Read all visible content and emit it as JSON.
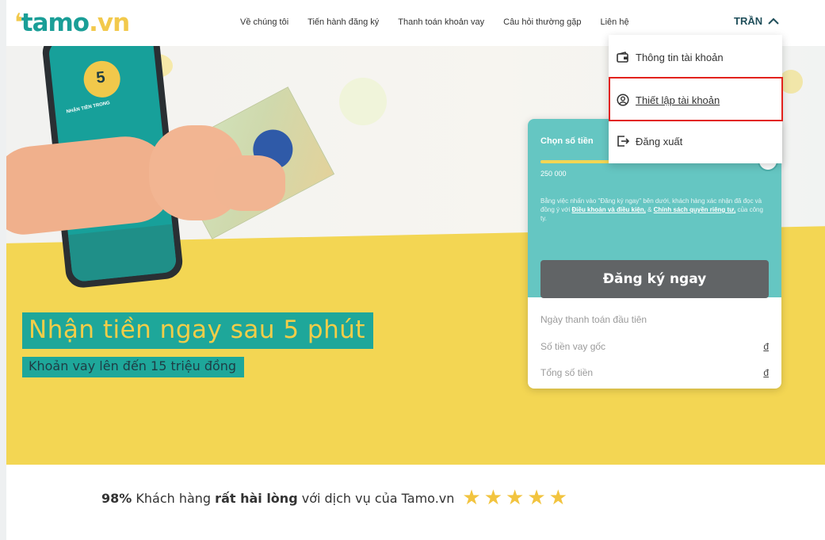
{
  "brand": {
    "logo_mark": "❛",
    "logo_name": "tamo",
    "logo_tld": ".vn"
  },
  "nav": {
    "items": [
      "Về chúng tôi",
      "Tiến hành đăng ký",
      "Thanh toán khoản vay",
      "Câu hỏi thường gặp",
      "Liên hệ"
    ],
    "user_label": "TRẦN"
  },
  "dropdown": {
    "items": [
      {
        "label": "Thông tin tài khoản",
        "icon": "wallet-icon"
      },
      {
        "label": "Thiết lập tài khoản",
        "icon": "user-circle-icon",
        "selected": true
      },
      {
        "label": "Đăng xuất",
        "icon": "logout-icon"
      }
    ],
    "highlight_color": "#e2221d"
  },
  "hero": {
    "phone_badge_text": "NHẬN TIỀN TRONG",
    "phone_badge_number": "5",
    "headline": "Nhận tiền ngay sau 5 phút",
    "subheadline": "Khoản vay lên đến 15 triệu đồng"
  },
  "calculator": {
    "choose_label": "Chọn số tiền",
    "amount": "250 000",
    "disclaimer_pre": "Bằng việc nhấn vào \"Đăng ký ngay\" bên dưới, khách hàng xác nhận đã đọc và đồng ý với ",
    "terms_link": "Điều khoản và điều kiện,",
    "disclaimer_mid": " & ",
    "privacy_link": "Chính sách quyền riêng tư,",
    "disclaimer_post": " của công ty.",
    "register_button": "Đăng ký ngay",
    "rows": [
      {
        "label": "Ngày thanh toán đầu tiên",
        "value": ""
      },
      {
        "label": "Số tiền vay gốc",
        "value": "đ"
      },
      {
        "label": "Tổng số tiền",
        "value": "đ"
      }
    ]
  },
  "rating": {
    "percent": "98%",
    "text_a": " Khách hàng ",
    "text_bold": "rất hài lòng",
    "text_b": " với dịch vụ của Tamo.vn",
    "stars": 5,
    "star_glyph": "★"
  },
  "colors": {
    "teal": "#1ea79a",
    "yellow": "#f3d653",
    "card_teal": "#65c6c2"
  }
}
